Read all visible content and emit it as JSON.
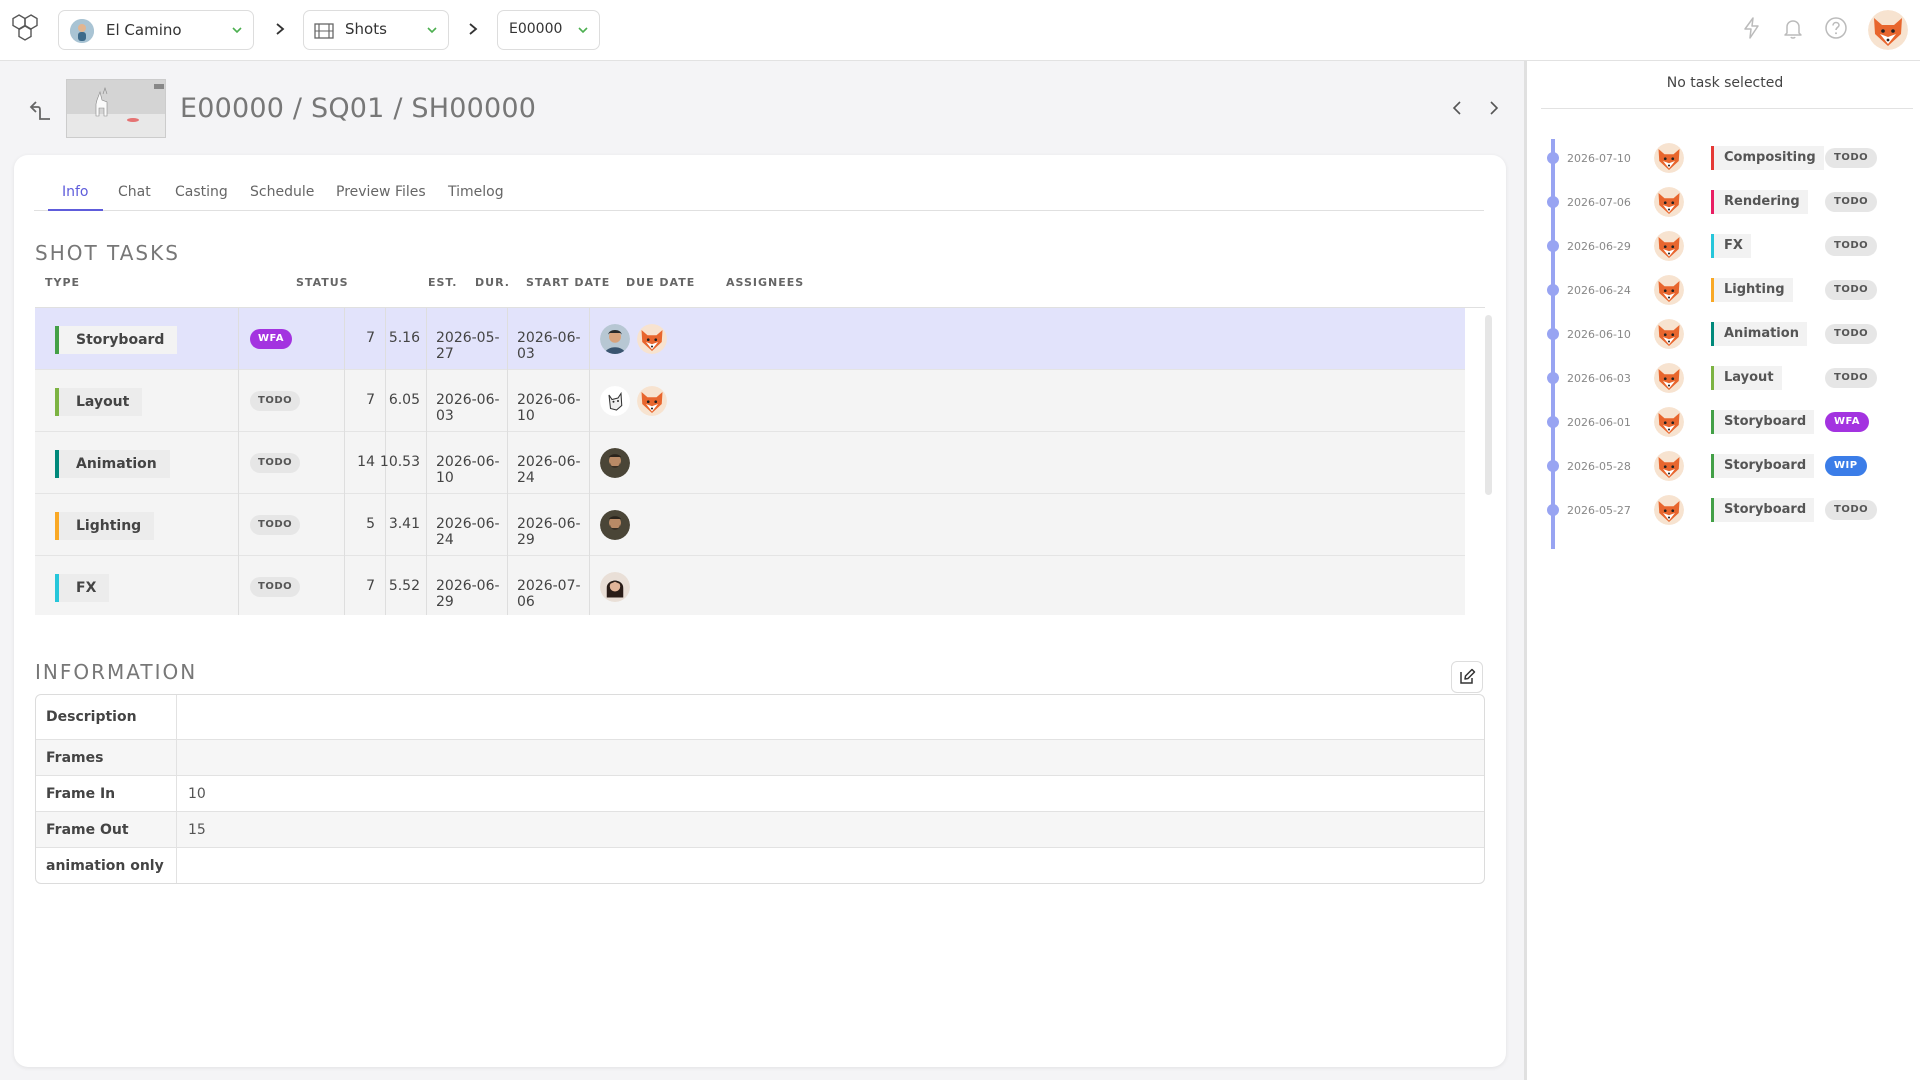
{
  "header": {
    "production": {
      "name": "El Camino"
    },
    "section": {
      "name": "Shots"
    },
    "episode": {
      "name": "E00000"
    }
  },
  "page": {
    "title": "E00000 / SQ01 / SH00000"
  },
  "tabs": [
    {
      "label": "Info",
      "active": true
    },
    {
      "label": "Chat"
    },
    {
      "label": "Casting"
    },
    {
      "label": "Schedule"
    },
    {
      "label": "Preview Files"
    },
    {
      "label": "Timelog"
    }
  ],
  "shot_tasks": {
    "title": "Shot tasks",
    "columns": {
      "type": "TYPE",
      "status": "STATUS",
      "est": "EST.",
      "dur": "DUR.",
      "start": "START DATE",
      "due": "DUE DATE",
      "assignees": "ASSIGNEES"
    },
    "rows": [
      {
        "type": "Storyboard",
        "type_color": "#43a047",
        "status": "WFA",
        "est": "7",
        "dur": "5.16",
        "start": "2026-05-27",
        "due": "2026-06-03",
        "assignees": [
          "man-dark-hair",
          "fox"
        ]
      },
      {
        "type": "Layout",
        "type_color": "#7cb342",
        "status": "TODO",
        "est": "7",
        "dur": "6.05",
        "start": "2026-06-03",
        "due": "2026-06-10",
        "assignees": [
          "cat-sketch",
          "fox"
        ]
      },
      {
        "type": "Animation",
        "type_color": "#00897b",
        "status": "TODO",
        "est": "14",
        "dur": "10.53",
        "start": "2026-06-10",
        "due": "2026-06-24",
        "assignees": [
          "bearded-man"
        ]
      },
      {
        "type": "Lighting",
        "type_color": "#f9a825",
        "status": "TODO",
        "est": "5",
        "dur": "3.41",
        "start": "2026-06-24",
        "due": "2026-06-29",
        "assignees": [
          "bearded-man"
        ]
      },
      {
        "type": "FX",
        "type_color": "#26c6da",
        "status": "TODO",
        "est": "7",
        "dur": "5.52",
        "start": "2026-06-29",
        "due": "2026-07-06",
        "assignees": [
          "woman"
        ]
      }
    ]
  },
  "information": {
    "title": "Information",
    "fields": [
      {
        "key": "Description",
        "value": ""
      },
      {
        "key": "Frames",
        "value": ""
      },
      {
        "key": "Frame In",
        "value": "10"
      },
      {
        "key": "Frame Out",
        "value": "15"
      },
      {
        "key": "animation only",
        "value": ""
      }
    ]
  },
  "side_panel": {
    "title": "No task selected",
    "timeline": [
      {
        "date": "2026-07-10",
        "task": "Compositing",
        "color": "#e53935",
        "status": "TODO"
      },
      {
        "date": "2026-07-06",
        "task": "Rendering",
        "color": "#e91e63",
        "status": "TODO"
      },
      {
        "date": "2026-06-29",
        "task": "FX",
        "color": "#26c6da",
        "status": "TODO"
      },
      {
        "date": "2026-06-24",
        "task": "Lighting",
        "color": "#f9a825",
        "status": "TODO"
      },
      {
        "date": "2026-06-10",
        "task": "Animation",
        "color": "#00897b",
        "status": "TODO"
      },
      {
        "date": "2026-06-03",
        "task": "Layout",
        "color": "#7cb342",
        "status": "TODO"
      },
      {
        "date": "2026-06-01",
        "task": "Storyboard",
        "color": "#43a047",
        "status": "WFA"
      },
      {
        "date": "2026-05-28",
        "task": "Storyboard",
        "color": "#43a047",
        "status": "WIP"
      },
      {
        "date": "2026-05-27",
        "task": "Storyboard",
        "color": "#43a047",
        "status": "TODO"
      }
    ]
  },
  "status_colors": {
    "WFA": {
      "bg": "#a333e0",
      "fg": "#ffffff"
    },
    "WIP": {
      "bg": "#3b7de8",
      "fg": "#ffffff"
    },
    "TODO": {
      "bg": "#e6e6e6",
      "fg": "#555555"
    }
  },
  "accent": "#5e5cdb"
}
